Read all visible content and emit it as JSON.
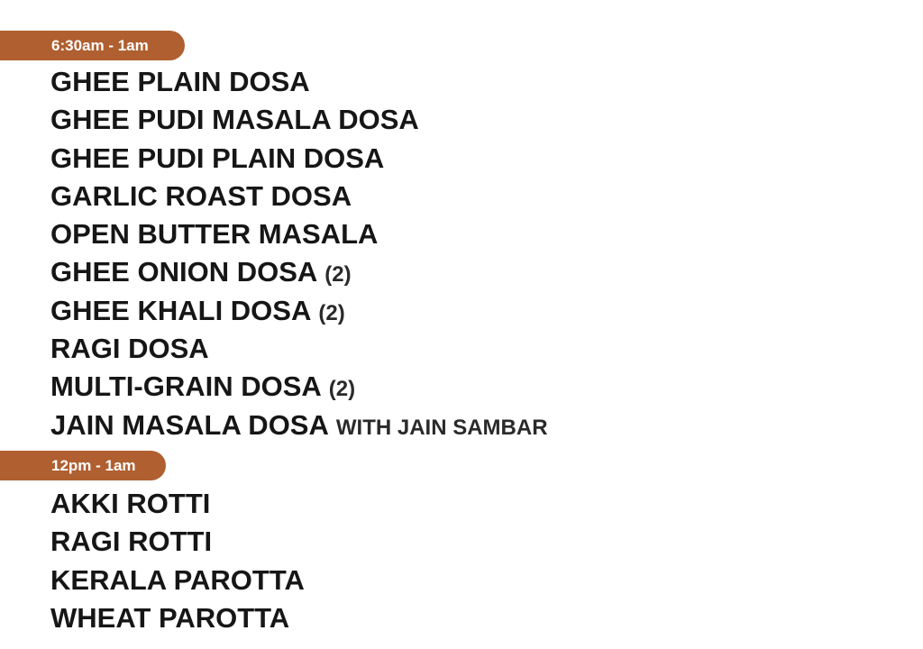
{
  "sections": [
    {
      "time": "6:30am - 1am",
      "items": [
        {
          "name": "GHEE PLAIN DOSA",
          "note": ""
        },
        {
          "name": "GHEE PUDI MASALA DOSA",
          "note": ""
        },
        {
          "name": "GHEE PUDI PLAIN DOSA",
          "note": ""
        },
        {
          "name": "GARLIC ROAST DOSA",
          "note": ""
        },
        {
          "name": "OPEN BUTTER MASALA",
          "note": ""
        },
        {
          "name": "GHEE ONION DOSA",
          "note": "(2)"
        },
        {
          "name": "GHEE KHALI DOSA",
          "note": "(2)"
        },
        {
          "name": "RAGI DOSA",
          "note": ""
        },
        {
          "name": "MULTI-GRAIN DOSA",
          "note": "(2)"
        },
        {
          "name": "JAIN MASALA DOSA",
          "note": "WITH JAIN SAMBAR"
        }
      ]
    },
    {
      "time": "12pm - 1am",
      "items": [
        {
          "name": "AKKI ROTTI",
          "note": ""
        },
        {
          "name": "RAGI ROTTI",
          "note": ""
        },
        {
          "name": "KERALA PAROTTA",
          "note": ""
        },
        {
          "name": "WHEAT PAROTTA",
          "note": ""
        }
      ]
    }
  ],
  "colors": {
    "badge": "#b05f30",
    "text": "#161616"
  }
}
